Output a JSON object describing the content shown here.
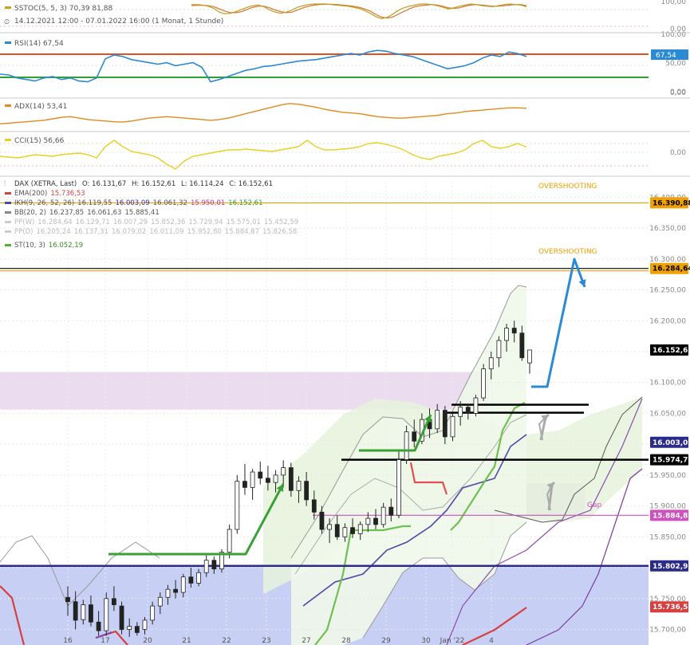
{
  "chart_data": {
    "type": "candlestick",
    "instrument": "DAX (XETRA, Last)",
    "period_label": "14.12.2021 12:00 - 07.01.2022 16:00  (1 Monat, 1 Stunde)",
    "ohlc_label": {
      "o": "O: 16.131,67",
      "h": "H: 16.152,61",
      "l": "L: 16.114,24",
      "c": "C: 16.152,61"
    },
    "x_ticks": [
      "16",
      "17",
      "20",
      "21",
      "22",
      "23",
      "27",
      "28",
      "29",
      "30",
      "Jan '22",
      "4"
    ],
    "y_ticks": [
      "16.400,00",
      "16.350,00",
      "16.300,00",
      "16.250,00",
      "16.200,00",
      "16.150,00",
      "16.100,00",
      "16.050,00",
      "16.000,00",
      "15.950,00",
      "15.900,00",
      "15.850,00",
      "15.800,00",
      "15.750,00",
      "15.700,00"
    ],
    "ylim": [
      15680,
      16425
    ],
    "legend": [
      {
        "label": "EMA(200)",
        "value": "15.736,53",
        "color": "#d84040"
      },
      {
        "label": "IKH(9, 26, 52, 26)",
        "values": [
          "16.119,55",
          "16.003,09",
          "16.061,32",
          "15.950,01",
          "16.152,61"
        ],
        "color": "#4a4aa8"
      },
      {
        "label": "BB(20, 2)",
        "values": [
          "16.237,85",
          "16.061,63",
          "15.885,41"
        ],
        "color": "#888888"
      },
      {
        "label": "PP(W)",
        "values": [
          "16.284,64",
          "16.129,71",
          "16.007,29",
          "15.852,36",
          "15.729,94",
          "15.575,01",
          "15.452,59"
        ],
        "color": "#bbbbbb"
      },
      {
        "label": "PP(D)",
        "values": [
          "16.205,24",
          "16.137,31",
          "16.079,02",
          "16.011,09",
          "15.952,80",
          "15.884,87",
          "15.826,58"
        ],
        "color": "#bbbbbb"
      },
      {
        "label": "ST(10, 3)",
        "value": "16.052,19",
        "color": "#56b030"
      }
    ],
    "annotations": [
      "OVERSHOOTING",
      "OVERSHOOTING",
      "Gap"
    ],
    "price_tags": [
      {
        "value": 16390.88,
        "label": "16.390,88",
        "color": "#f0a000",
        "text": "#000000"
      },
      {
        "value": 16284.64,
        "label": "16.284,64",
        "color": "#f0a000",
        "text": "#000000"
      },
      {
        "value": 16152.61,
        "label": "16.152,61",
        "color": "#000000",
        "text": "#ffffff"
      },
      {
        "value": 16003.09,
        "label": "16.003,09",
        "color": "#2b2b8c",
        "text": "#ffffff"
      },
      {
        "value": 15974.79,
        "label": "15.974,79",
        "color": "#000000",
        "text": "#ffffff"
      },
      {
        "value": 15884.88,
        "label": "15.884,88",
        "color": "#d050c0",
        "text": "#ffffff"
      },
      {
        "value": 15802.97,
        "label": "15.802,97",
        "color": "#2b2b8c",
        "text": "#ffffff"
      },
      {
        "value": 15736.53,
        "label": "15.736,53",
        "color": "#d84040",
        "text": "#ffffff"
      }
    ],
    "horizontal_levels": [
      {
        "value": 16390.88,
        "color": "#f0a000",
        "note": "overshooting target"
      },
      {
        "value": 16284.64,
        "color": "#000000",
        "note": "overshooting target"
      },
      {
        "value": 16064,
        "color": "#000000",
        "note": "resistance"
      },
      {
        "value": 16051,
        "color": "#000000",
        "note": "resistance"
      },
      {
        "value": 15974.79,
        "color": "#000000",
        "note": "breakout line"
      },
      {
        "value": 15884.88,
        "color": "#d050c0",
        "note": "gap"
      },
      {
        "value": 15802.97,
        "color": "#2b2b8c",
        "note": "support"
      }
    ],
    "candles": [
      {
        "o": 15752,
        "h": 15770,
        "l": 15722,
        "c": 15745
      },
      {
        "o": 15745,
        "h": 15762,
        "l": 15700,
        "c": 15715
      },
      {
        "o": 15716,
        "h": 15748,
        "l": 15708,
        "c": 15740
      },
      {
        "o": 15740,
        "h": 15755,
        "l": 15705,
        "c": 15712
      },
      {
        "o": 15712,
        "h": 15730,
        "l": 15690,
        "c": 15698
      },
      {
        "o": 15698,
        "h": 15760,
        "l": 15690,
        "c": 15750
      },
      {
        "o": 15750,
        "h": 15770,
        "l": 15730,
        "c": 15740
      },
      {
        "o": 15738,
        "h": 15745,
        "l": 15692,
        "c": 15700
      },
      {
        "o": 15700,
        "h": 15718,
        "l": 15688,
        "c": 15705
      },
      {
        "o": 15705,
        "h": 15712,
        "l": 15690,
        "c": 15695
      },
      {
        "o": 15700,
        "h": 15720,
        "l": 15692,
        "c": 15715
      },
      {
        "o": 15715,
        "h": 15745,
        "l": 15708,
        "c": 15738
      },
      {
        "o": 15738,
        "h": 15760,
        "l": 15725,
        "c": 15752
      },
      {
        "o": 15752,
        "h": 15772,
        "l": 15740,
        "c": 15765
      },
      {
        "o": 15765,
        "h": 15780,
        "l": 15750,
        "c": 15760
      },
      {
        "o": 15760,
        "h": 15790,
        "l": 15752,
        "c": 15785
      },
      {
        "o": 15785,
        "h": 15800,
        "l": 15768,
        "c": 15775
      },
      {
        "o": 15775,
        "h": 15798,
        "l": 15770,
        "c": 15792
      },
      {
        "o": 15792,
        "h": 15820,
        "l": 15785,
        "c": 15812
      },
      {
        "o": 15812,
        "h": 15818,
        "l": 15790,
        "c": 15798
      },
      {
        "o": 15798,
        "h": 15830,
        "l": 15792,
        "c": 15825
      },
      {
        "o": 15825,
        "h": 15870,
        "l": 15815,
        "c": 15862
      },
      {
        "o": 15862,
        "h": 15950,
        "l": 15855,
        "c": 15940
      },
      {
        "o": 15940,
        "h": 15968,
        "l": 15918,
        "c": 15930
      },
      {
        "o": 15930,
        "h": 15960,
        "l": 15910,
        "c": 15955
      },
      {
        "o": 15955,
        "h": 15972,
        "l": 15935,
        "c": 15945
      },
      {
        "o": 15945,
        "h": 15965,
        "l": 15925,
        "c": 15938
      },
      {
        "o": 15938,
        "h": 15958,
        "l": 15922,
        "c": 15950
      },
      {
        "o": 15950,
        "h": 15974,
        "l": 15930,
        "c": 15962
      },
      {
        "o": 15962,
        "h": 15970,
        "l": 15915,
        "c": 15925
      },
      {
        "o": 15925,
        "h": 15948,
        "l": 15905,
        "c": 15940
      },
      {
        "o": 15940,
        "h": 15955,
        "l": 15900,
        "c": 15910
      },
      {
        "o": 15910,
        "h": 15925,
        "l": 15878,
        "c": 15890
      },
      {
        "o": 15890,
        "h": 15900,
        "l": 15855,
        "c": 15862
      },
      {
        "o": 15862,
        "h": 15880,
        "l": 15840,
        "c": 15870
      },
      {
        "o": 15870,
        "h": 15885,
        "l": 15845,
        "c": 15850
      },
      {
        "o": 15850,
        "h": 15872,
        "l": 15842,
        "c": 15865
      },
      {
        "o": 15865,
        "h": 15880,
        "l": 15848,
        "c": 15855
      },
      {
        "o": 15855,
        "h": 15875,
        "l": 15845,
        "c": 15870
      },
      {
        "o": 15870,
        "h": 15890,
        "l": 15858,
        "c": 15880
      },
      {
        "o": 15880,
        "h": 15895,
        "l": 15862,
        "c": 15870
      },
      {
        "o": 15870,
        "h": 15905,
        "l": 15865,
        "c": 15898
      },
      {
        "o": 15898,
        "h": 15912,
        "l": 15875,
        "c": 15885
      },
      {
        "o": 15885,
        "h": 15990,
        "l": 15880,
        "c": 15975
      },
      {
        "o": 15975,
        "h": 16030,
        "l": 15968,
        "c": 16020
      },
      {
        "o": 16020,
        "h": 16040,
        "l": 15995,
        "c": 16005
      },
      {
        "o": 16005,
        "h": 16050,
        "l": 16000,
        "c": 16040
      },
      {
        "o": 16040,
        "h": 16058,
        "l": 16010,
        "c": 16025
      },
      {
        "o": 16025,
        "h": 16065,
        "l": 16018,
        "c": 16055
      },
      {
        "o": 16055,
        "h": 16062,
        "l": 16000,
        "c": 16012
      },
      {
        "o": 16012,
        "h": 16050,
        "l": 16005,
        "c": 16045
      },
      {
        "o": 16045,
        "h": 16070,
        "l": 16030,
        "c": 16060
      },
      {
        "o": 16060,
        "h": 16065,
        "l": 16040,
        "c": 16050
      },
      {
        "o": 16050,
        "h": 16080,
        "l": 16045,
        "c": 16075
      },
      {
        "o": 16075,
        "h": 16130,
        "l": 16070,
        "c": 16122
      },
      {
        "o": 16122,
        "h": 16150,
        "l": 16105,
        "c": 16140
      },
      {
        "o": 16140,
        "h": 16175,
        "l": 16125,
        "c": 16168
      },
      {
        "o": 16168,
        "h": 16195,
        "l": 16150,
        "c": 16188
      },
      {
        "o": 16188,
        "h": 16200,
        "l": 16165,
        "c": 16180
      },
      {
        "o": 16180,
        "h": 16192,
        "l": 16135,
        "c": 16140
      },
      {
        "o": 16131.67,
        "h": 16152.61,
        "l": 16114.24,
        "c": 16152.61
      }
    ],
    "indicators": [
      {
        "name": "SSTOC(5, 5, 3)",
        "label": "SSTOC(5, 5, 3)  70,39  81,88",
        "values": [
          "70,39",
          "81,88"
        ],
        "ticks": [
          "100,00",
          "0,00"
        ],
        "range": [
          0,
          100
        ],
        "series_k": [
          92,
          92,
          90,
          86,
          78,
          64,
          58,
          60,
          66,
          74,
          82,
          88,
          90,
          84,
          72,
          64,
          60,
          64,
          72,
          82,
          88,
          92,
          94,
          94,
          94,
          92,
          90,
          88,
          86,
          82,
          78,
          70,
          60,
          48,
          40,
          44,
          56,
          70,
          80,
          86,
          90,
          94,
          94,
          92,
          88,
          82,
          76,
          80,
          86,
          90,
          94,
          92,
          88,
          86,
          84,
          88,
          92,
          94,
          92,
          90,
          84
        ],
        "series_d": [
          88,
          89,
          89,
          88,
          84,
          76,
          68,
          62,
          62,
          66,
          74,
          82,
          86,
          86,
          80,
          72,
          66,
          62,
          64,
          72,
          80,
          86,
          90,
          92,
          93,
          93,
          92,
          90,
          88,
          86,
          82,
          76,
          68,
          56,
          46,
          42,
          46,
          56,
          66,
          76,
          84,
          88,
          90,
          92,
          90,
          86,
          80,
          78,
          80,
          86,
          90,
          92,
          90,
          88,
          86,
          86,
          88,
          90,
          92,
          92,
          88
        ]
      },
      {
        "name": "RSI(14)",
        "label": "RSI(14)  67,54",
        "value": "67,54",
        "ticks": [
          "100,00",
          "50,00",
          "0,00"
        ],
        "range": [
          0,
          100
        ],
        "series": [
          45,
          44,
          40,
          38,
          36,
          40,
          42,
          38,
          40,
          36,
          35,
          40,
          65,
          70,
          68,
          64,
          62,
          60,
          58,
          60,
          56,
          58,
          60,
          54,
          35,
          38,
          42,
          46,
          50,
          52,
          55,
          56,
          58,
          60,
          62,
          63,
          64,
          66,
          68,
          70,
          72,
          70,
          74,
          76,
          75,
          72,
          70,
          68,
          64,
          60,
          56,
          52,
          54,
          56,
          60,
          66,
          70,
          68,
          74,
          72,
          68
        ]
      },
      {
        "name": "ADX(14)",
        "label": "ADX(14)  53,41",
        "value": "53,41",
        "ticks": [
          "0,00"
        ],
        "series": [
          10,
          12,
          14,
          16,
          18,
          20,
          24,
          28,
          30,
          26,
          22,
          20,
          18,
          16,
          15,
          18,
          22,
          26,
          28,
          30,
          28,
          26,
          24,
          22,
          20,
          22,
          26,
          32,
          38,
          44,
          50,
          56,
          62,
          66,
          64,
          60,
          56,
          50,
          46,
          42,
          40,
          38,
          34,
          30,
          28,
          26,
          26,
          28,
          30,
          32,
          34,
          38,
          40,
          44,
          46,
          48,
          50,
          52,
          54,
          54,
          53
        ]
      },
      {
        "name": "CCI(15)",
        "label": "CCI(15)  56,66",
        "value": "56,66",
        "ticks": [
          "0,00"
        ],
        "series": [
          -60,
          -70,
          -80,
          -60,
          -40,
          -50,
          -60,
          -40,
          -30,
          -20,
          -40,
          -80,
          60,
          140,
          60,
          0,
          -20,
          -40,
          -80,
          -160,
          -220,
          -120,
          -60,
          -40,
          -20,
          0,
          20,
          20,
          30,
          20,
          10,
          0,
          20,
          40,
          60,
          140,
          60,
          20,
          20,
          30,
          40,
          60,
          100,
          110,
          90,
          60,
          20,
          -40,
          -80,
          -100,
          -60,
          -40,
          -20,
          20,
          100,
          140,
          60,
          40,
          60,
          100,
          56
        ]
      }
    ]
  }
}
